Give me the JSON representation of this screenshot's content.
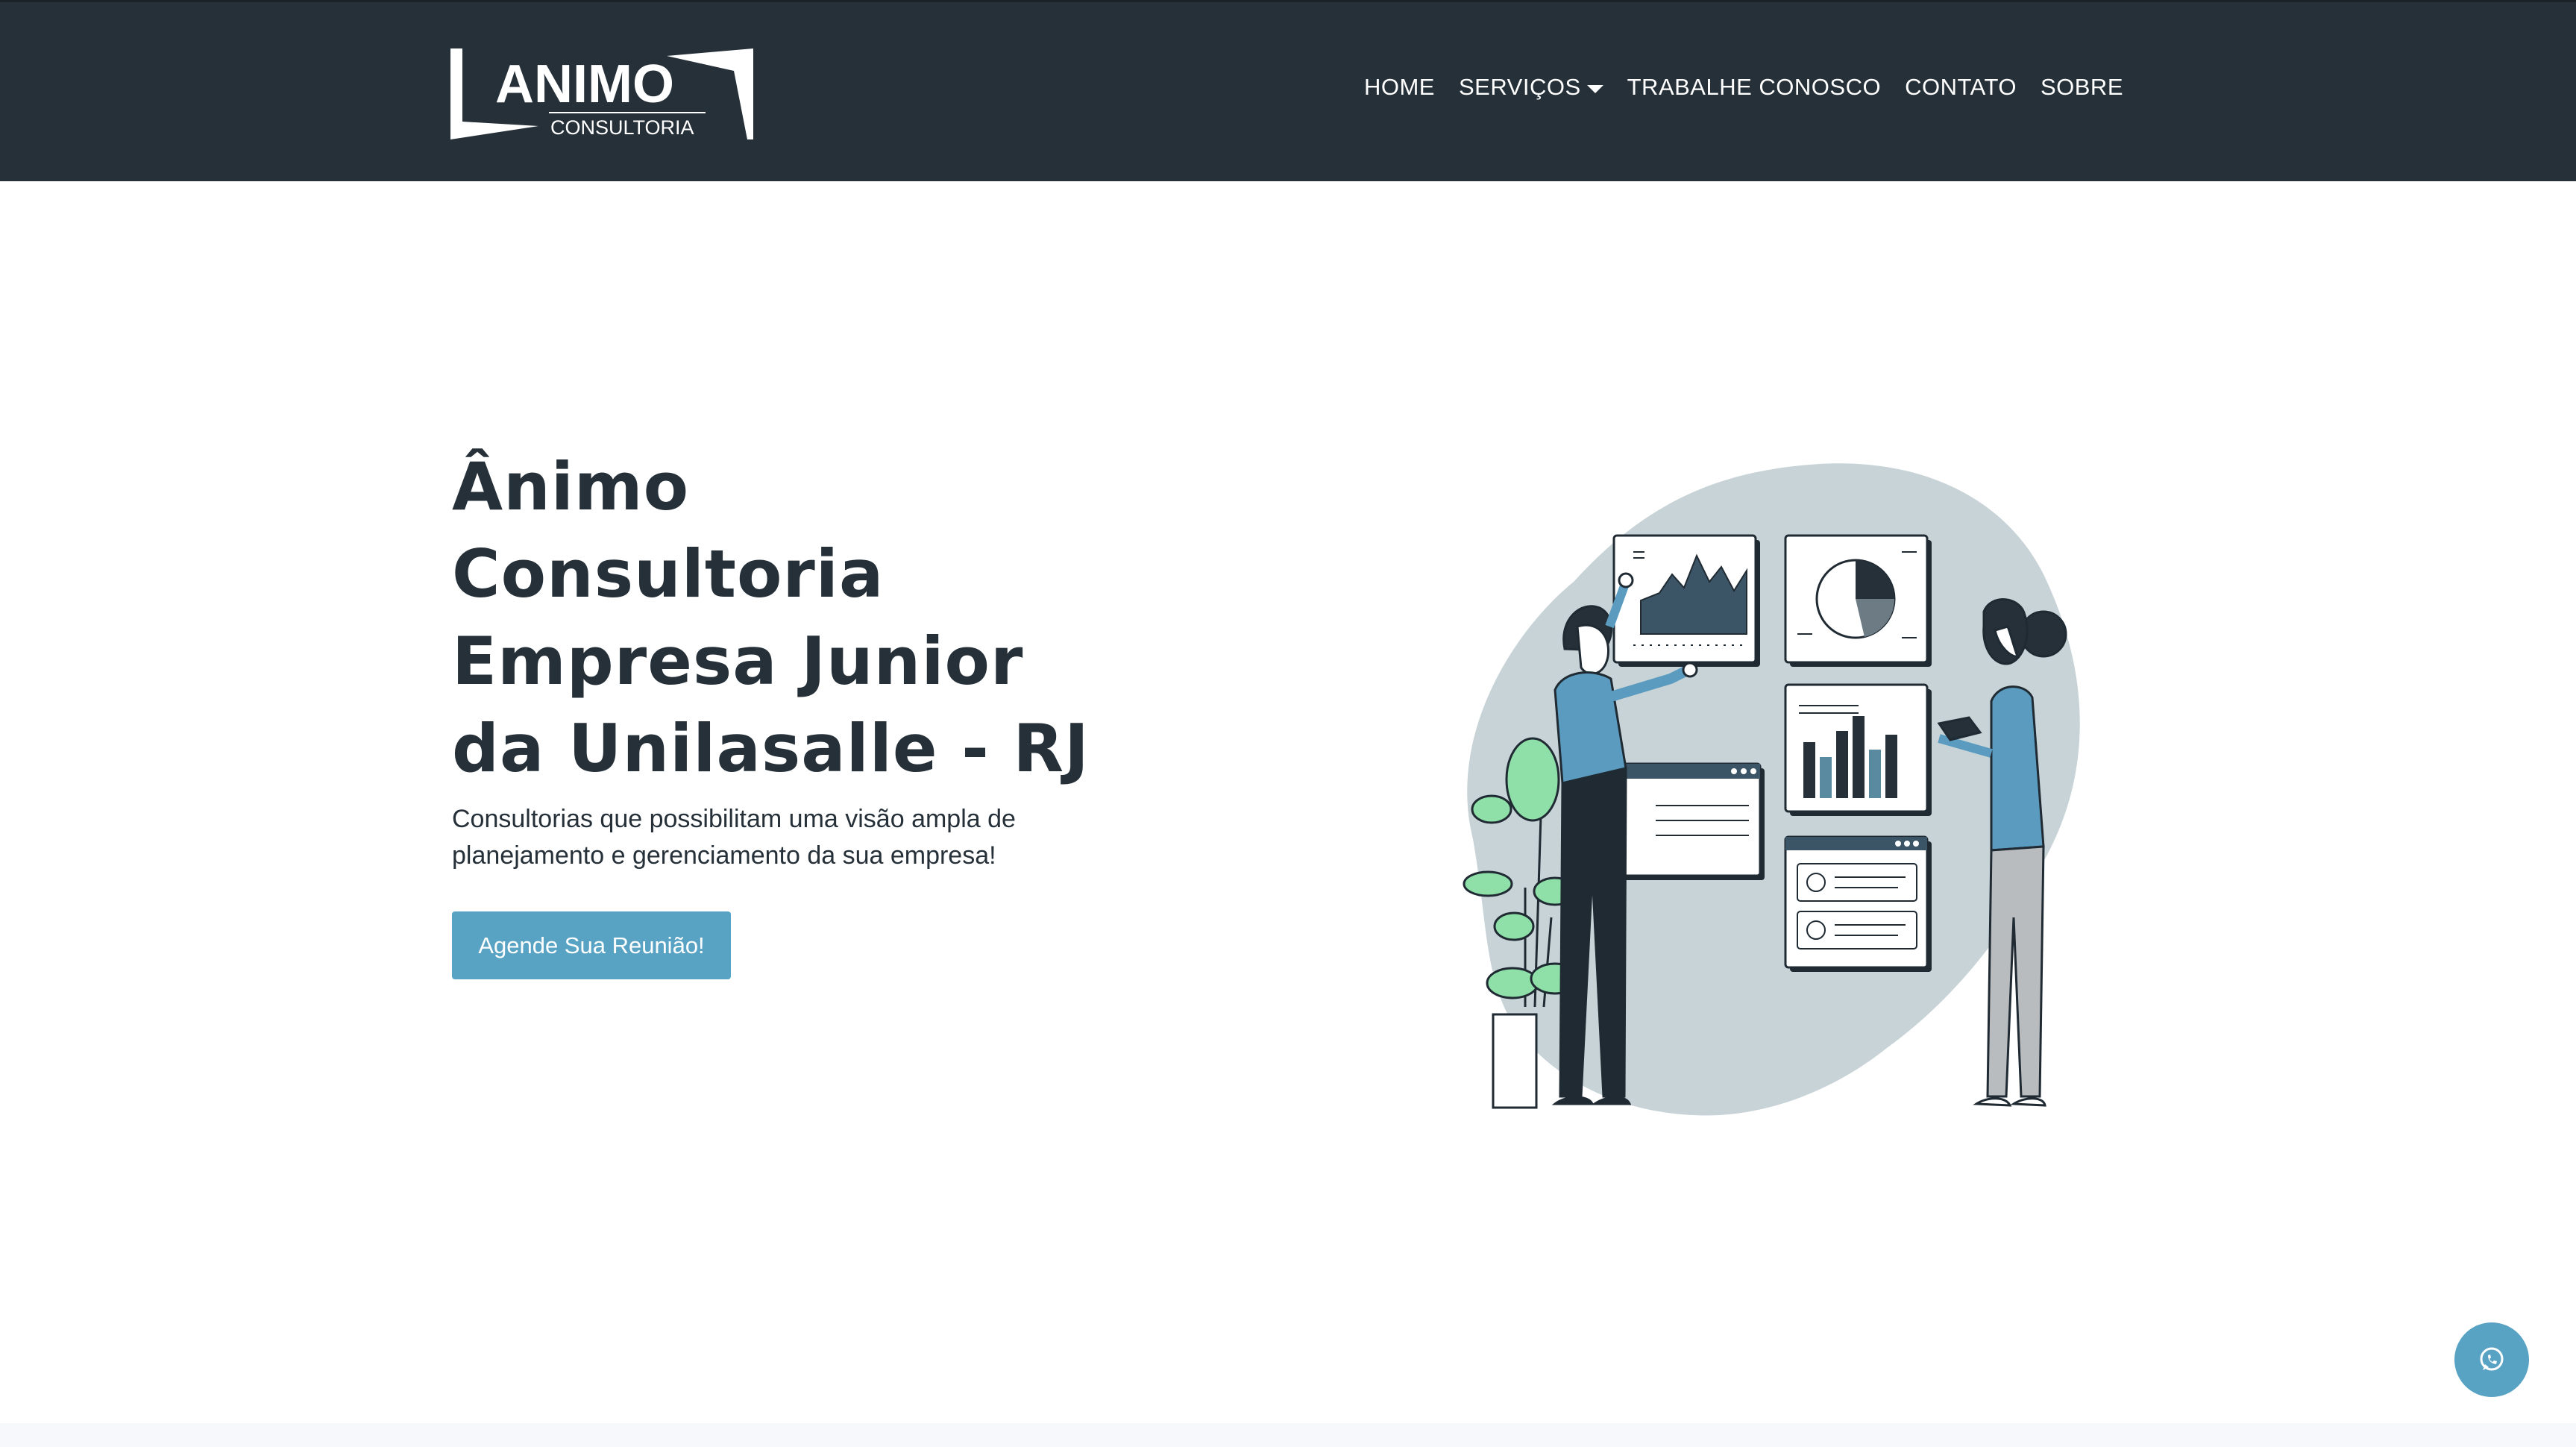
{
  "header": {
    "logo": {
      "name": "ANIMO",
      "tagline": "CONSULTORIA"
    },
    "nav": [
      {
        "label": "HOME"
      },
      {
        "label": "SERVIÇOS",
        "has_dropdown": true
      },
      {
        "label": "TRABALHE CONOSCO"
      },
      {
        "label": "CONTATO"
      },
      {
        "label": "SOBRE"
      }
    ]
  },
  "hero": {
    "title_lines": [
      "Ânimo",
      "Consultoria",
      "Empresa Junior",
      "da Unilasalle - RJ"
    ],
    "subtitle_lines": [
      "Consultorias que possibilitam uma visão ampla de",
      "planejamento e gerenciamento da sua empresa!"
    ],
    "cta_label": "Agende Sua Reunião!",
    "illustration": "business-analytics-people-with-dashboards"
  },
  "floating": {
    "icon": "whatsapp-icon"
  },
  "colors": {
    "header_bg": "#263039",
    "accent": "#58a3c4",
    "text_dark": "#263039",
    "blob": "#c8d3d7",
    "plant_green": "#8fdfa8"
  }
}
